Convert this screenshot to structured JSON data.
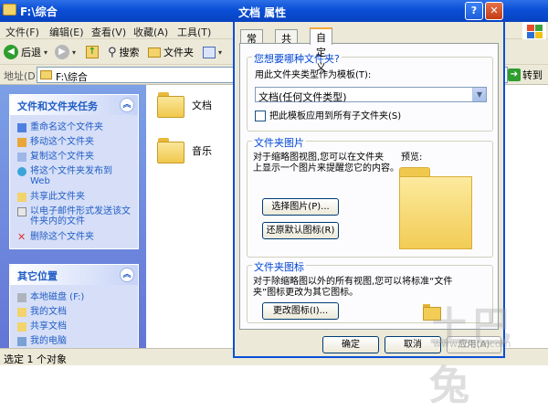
{
  "explorer": {
    "title": "F:\\综合",
    "menu": [
      "文件(F)",
      "编辑(E)",
      "查看(V)",
      "收藏(A)",
      "工具(T)",
      "帮助(H)"
    ],
    "toolbar": {
      "back": "后退",
      "search": "搜索",
      "folders": "文件夹"
    },
    "address": {
      "label": "地址(D)",
      "value": "F:\\综合",
      "go": "转到"
    },
    "tasks_panel": {
      "title": "文件和文件夹任务",
      "items": [
        "重命名这个文件夹",
        "移动这个文件夹",
        "复制这个文件夹",
        "将这个文件夹发布到 Web",
        "共享此文件夹",
        "以电子邮件形式发送该文件夹内的文件",
        "删除这个文件夹"
      ]
    },
    "other_panel": {
      "title": "其它位置",
      "items": [
        "本地磁盘 (F:)",
        "我的文档",
        "共享文档",
        "我的电脑"
      ]
    },
    "files": [
      {
        "name": "文档"
      },
      {
        "name": "音乐"
      }
    ],
    "status": "选定 1 个对象"
  },
  "dialog": {
    "title": "文档 属性",
    "tabs": [
      "常规",
      "共享",
      "自定义"
    ],
    "active_tab": "自定义",
    "group_type": {
      "title": "您想要哪种文件夹?",
      "prompt": "用此文件夹类型作为模板(T):",
      "template": "文档(任何文件类型)",
      "apply_all": "把此模板应用到所有子文件夹(S)",
      "apply_all_checked": false
    },
    "group_pictures": {
      "title": "文件夹图片",
      "desc_line1": "对于缩略图视图,您可以在文件夹",
      "desc_line2": "上显示一个图片来提醒您它的内容。",
      "preview_label": "预览:",
      "choose": "选择图片(P)...",
      "restore": "还原默认图标(R)"
    },
    "group_icons": {
      "title": "文件夹图标",
      "desc_line1": "对于除缩略图以外的所有视图,您可以将标准“文件",
      "desc_line2": "夹”图标更改为其它图标。",
      "change": "更改图标(I)..."
    },
    "buttons": {
      "ok": "确定",
      "cancel": "取消",
      "apply": "应用(A)"
    }
  },
  "watermark": {
    "text": "土巴兔",
    "sub": "www.to8to.com"
  },
  "colors": {
    "title_bar": "#0a4fd6",
    "task_pane": "#6375d6",
    "panel_title": "#215dc6",
    "group_title": "#0046d5"
  }
}
